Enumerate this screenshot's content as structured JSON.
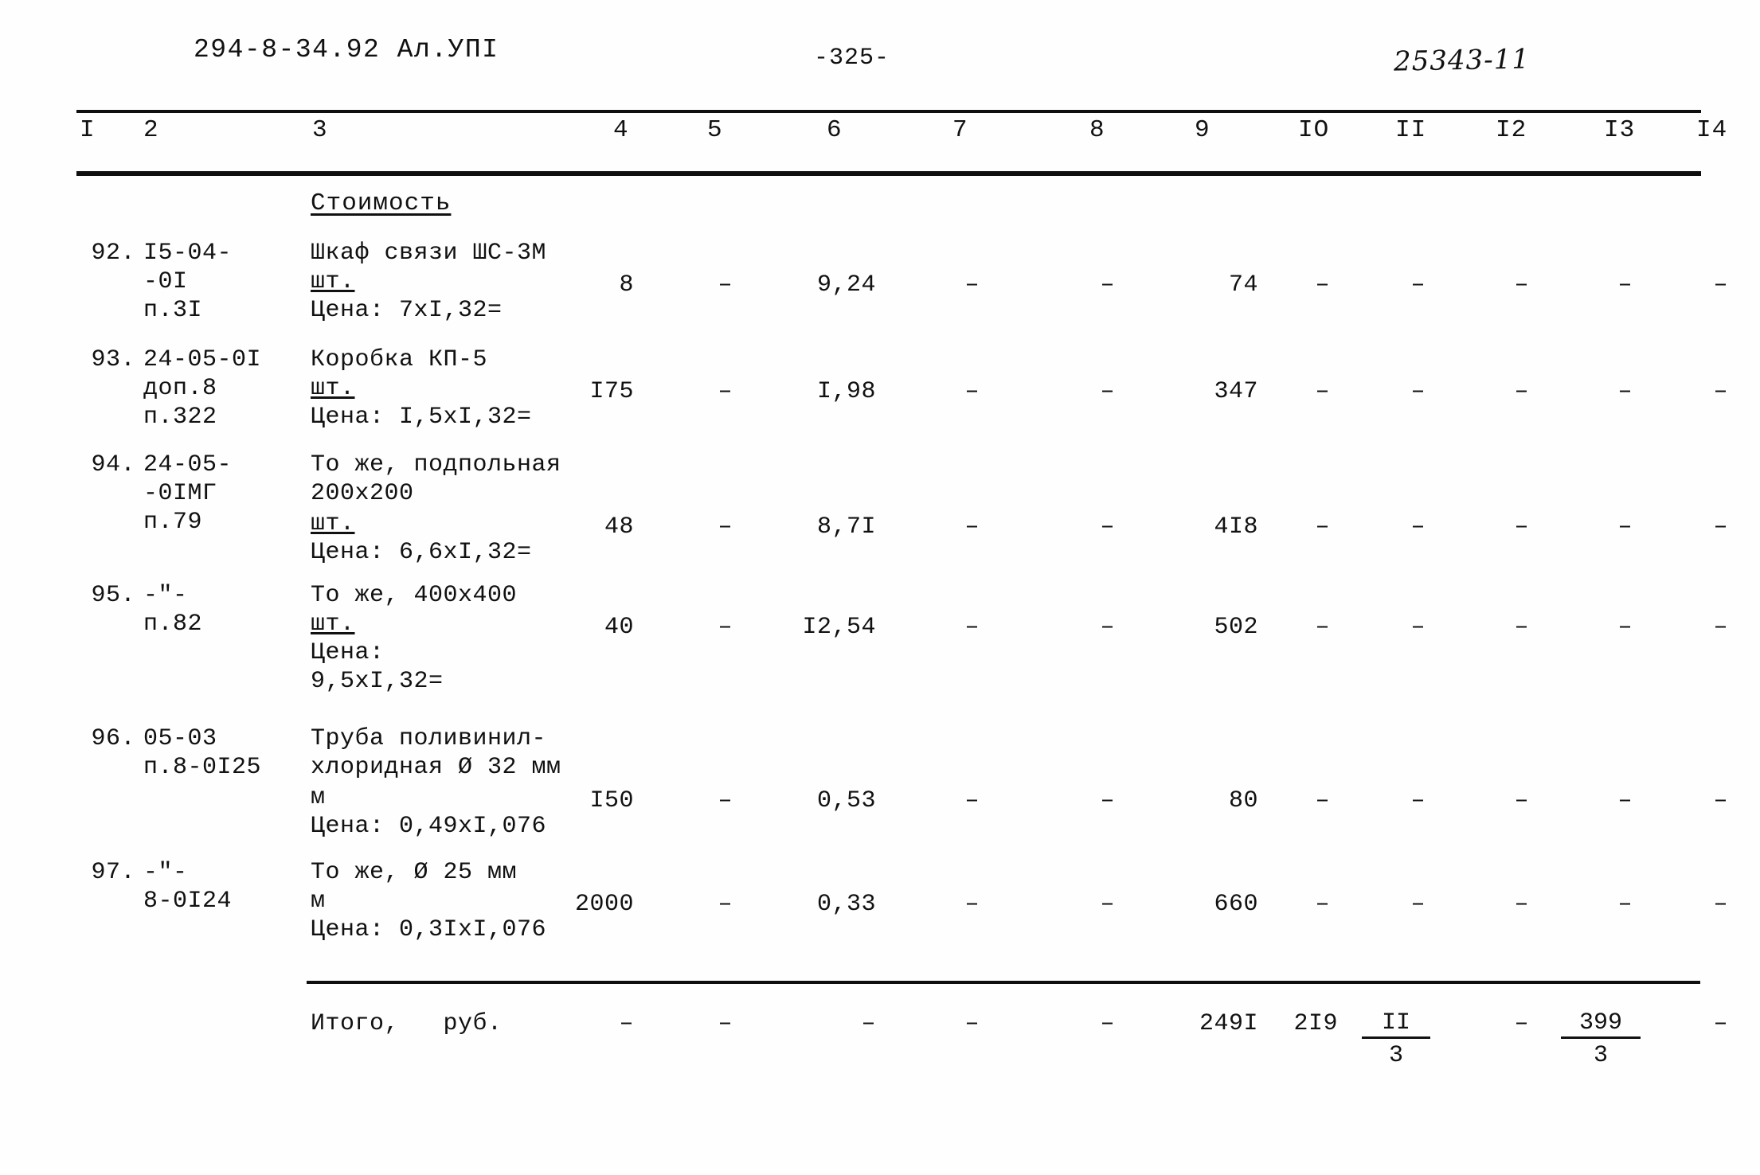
{
  "header": {
    "doc_code": "294-8-34.92  Ал.УПI",
    "page_number": "-325-",
    "sheet_code": "25343-11"
  },
  "table": {
    "column_headers": [
      "I",
      "2",
      "3",
      "4",
      "5",
      "6",
      "7",
      "8",
      "9",
      "IO",
      "II",
      "I2",
      "I3",
      "I4"
    ],
    "section_title": "Стоимость",
    "rows": [
      {
        "no": "92.",
        "code": "I5-04-\n-0I\nп.3I",
        "desc_line1": "Шкаф связи ШС-3М",
        "desc_unit": "шт.",
        "desc_price": "Цена: 7xI,32=",
        "c4": "8",
        "c5": "–",
        "c6": "9,24",
        "c7": "–",
        "c8": "–",
        "c9": "74",
        "c10": "–",
        "c11": "–",
        "c12": "–",
        "c13": "–",
        "c14": "–"
      },
      {
        "no": "93.",
        "code": "24-05-0I\nдоп.8\nп.322",
        "desc_line1": "Коробка КП-5",
        "desc_unit": "шт.",
        "desc_price": "Цена: I,5xI,32=",
        "c4": "I75",
        "c5": "–",
        "c6": "I,98",
        "c7": "–",
        "c8": "–",
        "c9": "347",
        "c10": "–",
        "c11": "–",
        "c12": "–",
        "c13": "–",
        "c14": "–"
      },
      {
        "no": "94.",
        "code": "24-05-\n-0IМГ\nп.79",
        "desc_line1": "То же, подпольная\n200x200",
        "desc_unit": "шт.",
        "desc_price": "Цена: 6,6xI,32=",
        "c4": "48",
        "c5": "–",
        "c6": "8,7I",
        "c7": "–",
        "c8": "–",
        "c9": "4I8",
        "c10": "–",
        "c11": "–",
        "c12": "–",
        "c13": "–",
        "c14": "–"
      },
      {
        "no": "95.",
        "code": "-\"-\nп.82",
        "desc_line1": "То же, 400x400",
        "desc_unit": "шт.",
        "desc_price": "Цена:\n9,5xI,32=",
        "c4": "40",
        "c5": "–",
        "c6": "I2,54",
        "c7": "–",
        "c8": "–",
        "c9": "502",
        "c10": "–",
        "c11": "–",
        "c12": "–",
        "c13": "–",
        "c14": "–"
      },
      {
        "no": "96.",
        "code": "05-03\nп.8-0I25",
        "desc_line1": "Труба поливинил-\nхлоридная Ø 32 мм",
        "desc_unit": "м",
        "desc_price": "Цена: 0,49xI,076",
        "c4": "I50",
        "c5": "–",
        "c6": "0,53",
        "c7": "–",
        "c8": "–",
        "c9": "80",
        "c10": "–",
        "c11": "–",
        "c12": "–",
        "c13": "–",
        "c14": "–"
      },
      {
        "no": "97.",
        "code": "-\"-\n8-0I24",
        "desc_line1": "То же, Ø 25 мм",
        "desc_unit": "м",
        "desc_price": "Цена: 0,3IxI,076",
        "c4": "2000",
        "c5": "–",
        "c6": "0,33",
        "c7": "–",
        "c8": "–",
        "c9": "660",
        "c10": "–",
        "c11": "–",
        "c12": "–",
        "c13": "–",
        "c14": "–"
      }
    ],
    "total_row": {
      "label": "Итого,   руб.",
      "c4": "–",
      "c5": "–",
      "c6": "–",
      "c7": "–",
      "c8": "–",
      "c9": "249I",
      "c10": "2I9",
      "c11_numerator": "II",
      "c11_denominator": "3",
      "c12": "–",
      "c13_numerator": "399",
      "c13_denominator": "3",
      "c14": "–"
    }
  }
}
